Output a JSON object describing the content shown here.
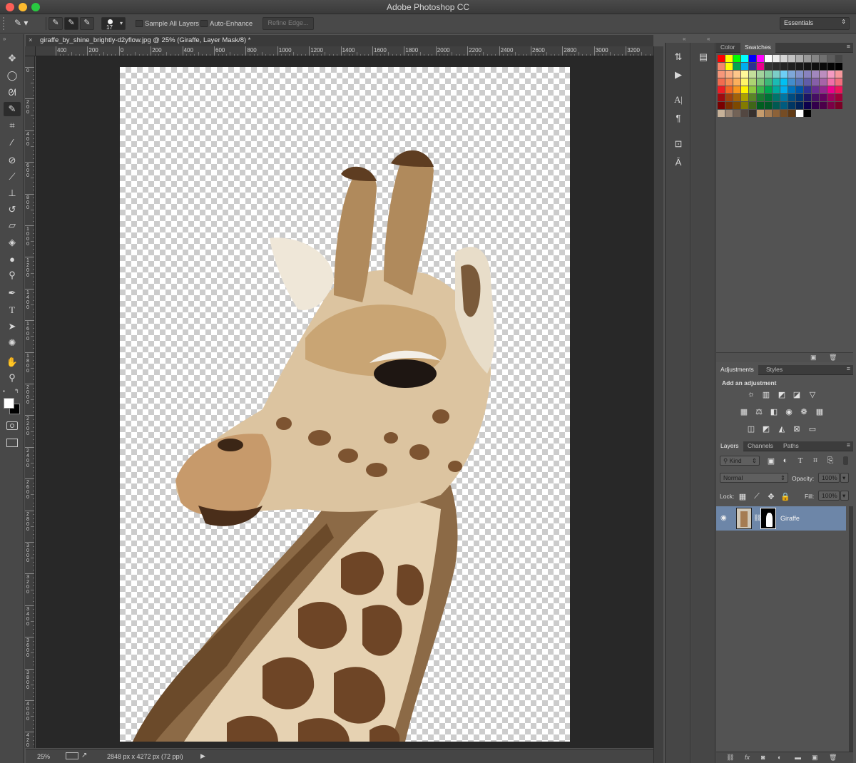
{
  "app": {
    "title": "Adobe Photoshop CC",
    "traffic_lights": [
      "#fc5f57",
      "#fdbb2e",
      "#29c941"
    ]
  },
  "options_bar": {
    "brush_size": "17",
    "sample_all_layers": "Sample All Layers",
    "auto_enhance": "Auto-Enhance",
    "refine_edge": "Refine Edge...",
    "workspace": "Essentials"
  },
  "document": {
    "tab_title": "giraffe_by_shine_brightly-d2yflow.jpg @ 25% (Giraffe, Layer Mask/8) *",
    "h_ruler_ticks": [
      "400",
      "200",
      "0",
      "200",
      "400",
      "600",
      "800",
      "1000",
      "1200",
      "1400",
      "1600",
      "1800",
      "2000",
      "2200",
      "2400",
      "2600",
      "2800",
      "3000",
      "3200"
    ],
    "v_ruler_ticks": [
      "0",
      "200",
      "400",
      "600",
      "800",
      "1000",
      "1200",
      "1400",
      "1600",
      "1800",
      "2000",
      "2200",
      "2400",
      "2600",
      "2800",
      "3000",
      "3200",
      "3400",
      "3600",
      "3800",
      "4000",
      "4200"
    ],
    "zoom": "25%",
    "doc_info": "2848 px x 4272 px (72 ppi)"
  },
  "tools": [
    "move-icon",
    "marquee-icon",
    "lasso-icon",
    "quick-selection-icon",
    "crop-icon",
    "eyedropper-icon",
    "healing-brush-icon",
    "brush-icon",
    "clone-stamp-icon",
    "history-brush-icon",
    "eraser-icon",
    "paint-bucket-icon",
    "blur-icon",
    "dodge-icon",
    "pen-icon",
    "type-icon",
    "path-selection-icon",
    "custom-shape-icon",
    "hand-icon",
    "zoom-icon"
  ],
  "color_panel": {
    "tabs": [
      "Color",
      "Swatches"
    ],
    "active": "Swatches",
    "swatch_rows": [
      [
        "#ff0000",
        "#ffff00",
        "#00ff00",
        "#00ffff",
        "#0000ff",
        "#ff00ff",
        "#ffffff",
        "#ebebeb",
        "#d6d6d6",
        "#c2c2c2",
        "#adadad",
        "#999999",
        "#858585",
        "#707070",
        "#5c5c5c",
        "#474747"
      ],
      [
        "#f5866b",
        "#ffff00",
        "#00a651",
        "#00aeef",
        "#2e3192",
        "#ec008c",
        "#333333",
        "#2b2b2b",
        "#242424",
        "#1f1f1f",
        "#1a1a1a",
        "#141414",
        "#0f0f0f",
        "#0a0a0a",
        "#050505",
        "#000000"
      ],
      [
        "#f7977a",
        "#fbad82",
        "#fdc68a",
        "#fff799",
        "#c4df9b",
        "#a3d39c",
        "#82ca9d",
        "#7bcdc8",
        "#6ecff6",
        "#7ea7d8",
        "#8493ca",
        "#8882be",
        "#a187be",
        "#bc8dbf",
        "#f49ac2",
        "#f6989d"
      ],
      [
        "#f26c4f",
        "#f68e55",
        "#fbaf5c",
        "#fff467",
        "#acd372",
        "#7cc576",
        "#3bb878",
        "#1abbb4",
        "#00bff3",
        "#438ccb",
        "#5574b9",
        "#605ca8",
        "#855fa8",
        "#a763a8",
        "#f06ea9",
        "#f26d7d"
      ],
      [
        "#ed1c24",
        "#f26522",
        "#f7941d",
        "#fff200",
        "#8dc73f",
        "#39b54a",
        "#00a651",
        "#00a99d",
        "#00aeef",
        "#0072bc",
        "#0054a6",
        "#2e3192",
        "#662d91",
        "#92278f",
        "#ec008c",
        "#ed145b"
      ],
      [
        "#9e0b0f",
        "#a0410d",
        "#a36209",
        "#aba000",
        "#598527",
        "#1a7b30",
        "#007236",
        "#00746b",
        "#0076a3",
        "#004b80",
        "#003471",
        "#1b1464",
        "#440e62",
        "#630460",
        "#9e005d",
        "#9e0039"
      ],
      [
        "#790000",
        "#7b2e00",
        "#7d4900",
        "#827b00",
        "#406618",
        "#005e20",
        "#005826",
        "#005952",
        "#005b7f",
        "#003663",
        "#002157",
        "#0d004c",
        "#32004b",
        "#4b0049",
        "#7b0046",
        "#7a0026"
      ],
      [
        "#c7b299",
        "#998675",
        "#736357",
        "#534741",
        "#37302d",
        "#c69c6d",
        "#a67c52",
        "#8c6239",
        "#754c24",
        "#603913",
        "#ffffff",
        "#000000"
      ]
    ]
  },
  "adjustments_panel": {
    "tabs": [
      "Adjustments",
      "Styles"
    ],
    "heading": "Add an adjustment",
    "row1": [
      "brightness-contrast-icon",
      "levels-icon",
      "curves-icon",
      "exposure-icon",
      "vibrance-icon"
    ],
    "row2": [
      "hue-saturation-icon",
      "color-balance-icon",
      "black-white-icon",
      "photo-filter-icon",
      "channel-mixer-icon",
      "color-lookup-icon"
    ],
    "row3": [
      "invert-icon",
      "posterize-icon",
      "threshold-icon",
      "selective-color-icon",
      "gradient-map-icon"
    ]
  },
  "layers_panel": {
    "tabs": [
      "Layers",
      "Channels",
      "Paths"
    ],
    "filter": "Kind",
    "blend_mode": "Normal",
    "opacity_label": "Opacity:",
    "opacity": "100%",
    "lock_label": "Lock:",
    "fill_label": "Fill:",
    "fill": "100%",
    "layer_name": "Giraffe",
    "selected_color": "#6d86a8"
  }
}
